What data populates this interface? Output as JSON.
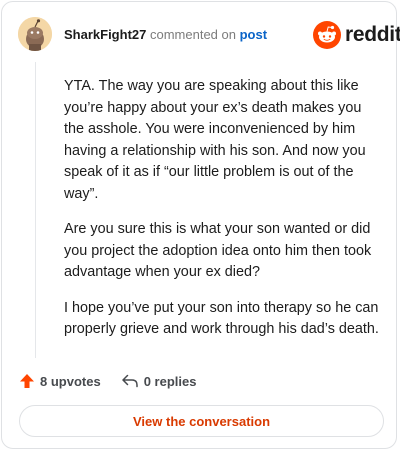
{
  "comment": {
    "username": "SharkFight27",
    "action_text": "commented on",
    "post_link": "post",
    "paragraphs": [
      "YTA. The way you are speaking about this like you’re happy about your ex’s death makes you the asshole. You were inconvenienced by him having a relationship with his son. And now you speak of it as if “our little problem is out of the way”.",
      "Are you sure this is what your son wanted or did you project the adoption idea onto him then took advantage when your ex died?",
      "I hope you’ve put your son into therapy so he can properly grieve and work through his dad’s death."
    ]
  },
  "brand": {
    "wordmark": "reddit",
    "color": "#ff4500"
  },
  "actions": {
    "upvotes": "8 upvotes",
    "replies": "0 replies",
    "upvote_icon": "upvote-arrow-icon",
    "reply_icon": "reply-arrow-icon"
  },
  "cta": {
    "label": "View the conversation",
    "color": "#d93a00"
  }
}
